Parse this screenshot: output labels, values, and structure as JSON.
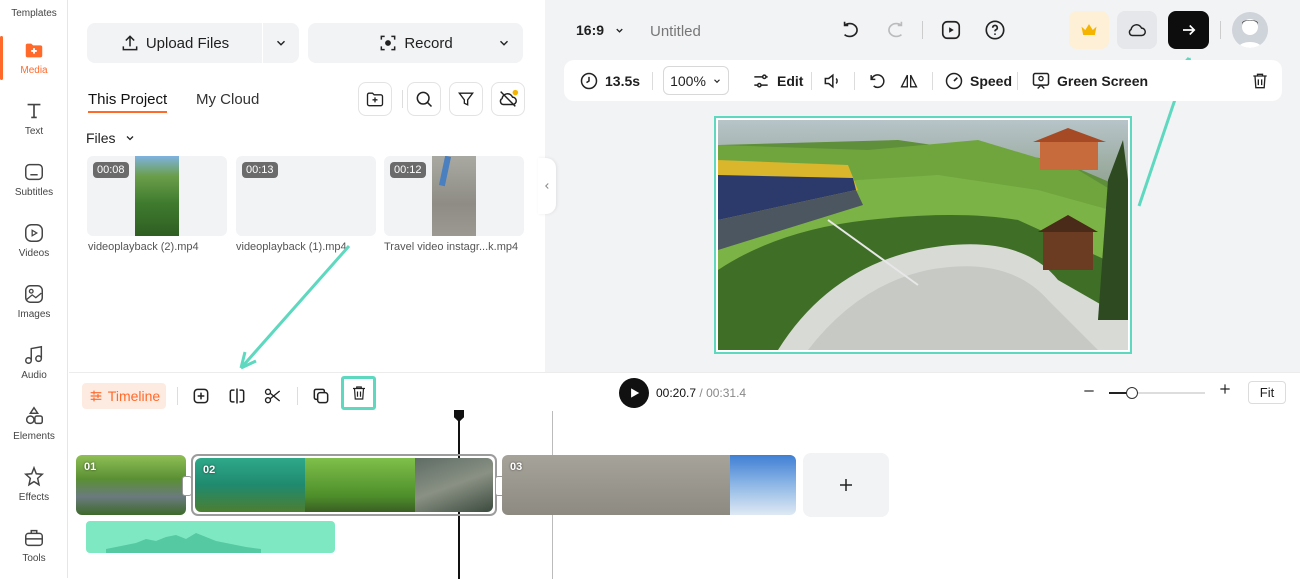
{
  "rail": {
    "items": [
      {
        "label": "Templates",
        "icon": "templates-icon"
      },
      {
        "label": "Media",
        "icon": "media-icon",
        "active": true
      },
      {
        "label": "Text",
        "icon": "text-icon"
      },
      {
        "label": "Subtitles",
        "icon": "subtitles-icon"
      },
      {
        "label": "Videos",
        "icon": "videos-icon"
      },
      {
        "label": "Images",
        "icon": "images-icon"
      },
      {
        "label": "Audio",
        "icon": "audio-icon"
      },
      {
        "label": "Elements",
        "icon": "elements-icon"
      },
      {
        "label": "Effects",
        "icon": "effects-icon"
      },
      {
        "label": "Tools",
        "icon": "tools-icon"
      }
    ],
    "accent": "#ff6a2b"
  },
  "media": {
    "upload_label": "Upload Files",
    "record_label": "Record",
    "tabs": [
      "This Project",
      "My Cloud"
    ],
    "files_label": "Files",
    "files": [
      {
        "duration": "00:08",
        "name": "videoplayback (2).mp4"
      },
      {
        "duration": "00:13",
        "name": "videoplayback (1).mp4"
      },
      {
        "duration": "00:12",
        "name": "Travel video instagr...k.mp4"
      }
    ]
  },
  "header": {
    "aspect": "16:9",
    "title": "Untitled"
  },
  "toolbar": {
    "duration": "13.5s",
    "zoom": "100%",
    "edit": "Edit",
    "speed": "Speed",
    "green_screen": "Green Screen"
  },
  "timeline": {
    "label": "Timeline",
    "current_time": "00:20.7",
    "separator": " / ",
    "total_time": "00:31.4",
    "fit_label": "Fit",
    "clips": [
      "01",
      "02",
      "03"
    ]
  },
  "colors": {
    "annotation": "#5ed8bf",
    "accent": "#ff6a2b",
    "audio": "#7ee8c3"
  }
}
